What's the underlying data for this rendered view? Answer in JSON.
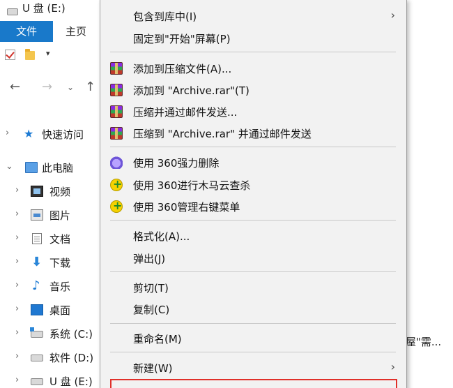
{
  "window": {
    "title": "U 盘 (E:)"
  },
  "ribbon": {
    "tab_file": "文件",
    "tab_home": "主页"
  },
  "quick_access_toolbar": {
    "dropdown": "▾"
  },
  "nav": {
    "back": "←",
    "forward": "→",
    "recent": "⌄",
    "up": "↑"
  },
  "tree": [
    {
      "label": "快速访问",
      "icon": "star-icon",
      "expander": "›"
    },
    {
      "label": "此电脑",
      "icon": "pc-icon",
      "expander": "⌄"
    },
    {
      "label": "视频",
      "icon": "video-icon",
      "expander": "›"
    },
    {
      "label": "图片",
      "icon": "pictures-icon",
      "expander": "›"
    },
    {
      "label": "文档",
      "icon": "documents-icon",
      "expander": "›"
    },
    {
      "label": "下载",
      "icon": "download-icon",
      "expander": "›"
    },
    {
      "label": "音乐",
      "icon": "music-icon",
      "expander": "›"
    },
    {
      "label": "桌面",
      "icon": "desktop-icon",
      "expander": "›"
    },
    {
      "label": "系统 (C:)",
      "icon": "system-drive-icon",
      "expander": "›"
    },
    {
      "label": "软件 (D:)",
      "icon": "drive-icon",
      "expander": "›"
    },
    {
      "label": "U 盘 (E:)",
      "icon": "usb-drive-icon",
      "expander": "›"
    }
  ],
  "background_text": "屋\"需...",
  "context_menu": {
    "items": [
      {
        "label": "包含到库中(I)",
        "submenu": "›"
      },
      {
        "label": "固定到\"开始\"屏幕(P)"
      },
      {
        "label": "添加到压缩文件(A)...",
        "icon": "winrar-icon"
      },
      {
        "label": "添加到 \"Archive.rar\"(T)",
        "icon": "winrar-icon"
      },
      {
        "label": "压缩并通过邮件发送...",
        "icon": "winrar-icon"
      },
      {
        "label": "压缩到 \"Archive.rar\" 并通过邮件发送",
        "icon": "winrar-icon"
      },
      {
        "label": "使用 360强力删除",
        "icon": "360-shred-icon"
      },
      {
        "label": "使用 360进行木马云查杀",
        "icon": "360-icon"
      },
      {
        "label": "使用 360管理右键菜单",
        "icon": "360-icon"
      },
      {
        "label": "格式化(A)..."
      },
      {
        "label": "弹出(J)"
      },
      {
        "label": "剪切(T)"
      },
      {
        "label": "复制(C)"
      },
      {
        "label": "重命名(M)"
      },
      {
        "label": "新建(W)",
        "submenu": "›"
      }
    ]
  },
  "colors": {
    "file_tab": "#1979ca",
    "menu_bg": "#f2f2f2",
    "highlight_box": "#e0302a"
  }
}
